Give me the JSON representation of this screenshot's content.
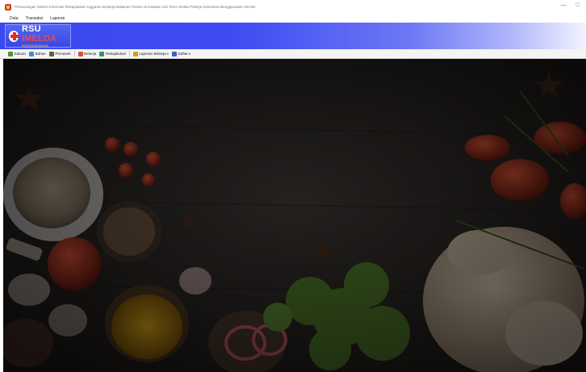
{
  "window": {
    "title": "Perancangan Sistem Informasi Rekapitulasi Anggaran Belanja Makanan Pasien di Instalasi Gizi RSU Imelda Pekerja Indonesia Menggunakan VB.Net",
    "controls": [
      "—",
      "□"
    ]
  },
  "menu": {
    "items": [
      "Data",
      "Transaksi",
      "Laporan"
    ]
  },
  "banner": {
    "logo_rsu": "RSU",
    "logo_name": "IMELDA",
    "logo_sub": "PEKERJA INDONESIA"
  },
  "toolbar": {
    "items": [
      {
        "label": "Satuan",
        "icon": "ruler-icon",
        "color": "#5a8e3a"
      },
      {
        "label": "Bahan",
        "icon": "box-icon",
        "color": "#4a8ac9"
      },
      {
        "label": "Pemasok",
        "icon": "truck-icon",
        "color": "#6c5a3c"
      },
      {
        "label": "Belanja",
        "icon": "cart-icon",
        "color": "#c95b2a"
      },
      {
        "label": "Rekapitulasi",
        "icon": "table-icon",
        "color": "#3a8e6c"
      },
      {
        "label": "Laporan Belanja",
        "icon": "report-icon",
        "color": "#d4a017"
      },
      {
        "label": "Daftar",
        "icon": "list-icon",
        "color": "#4060c0"
      }
    ]
  },
  "colors": {
    "banner_start": "#3b49f0",
    "banner_end": "#f2f3ff",
    "workspace_bg": "#2a2624"
  }
}
